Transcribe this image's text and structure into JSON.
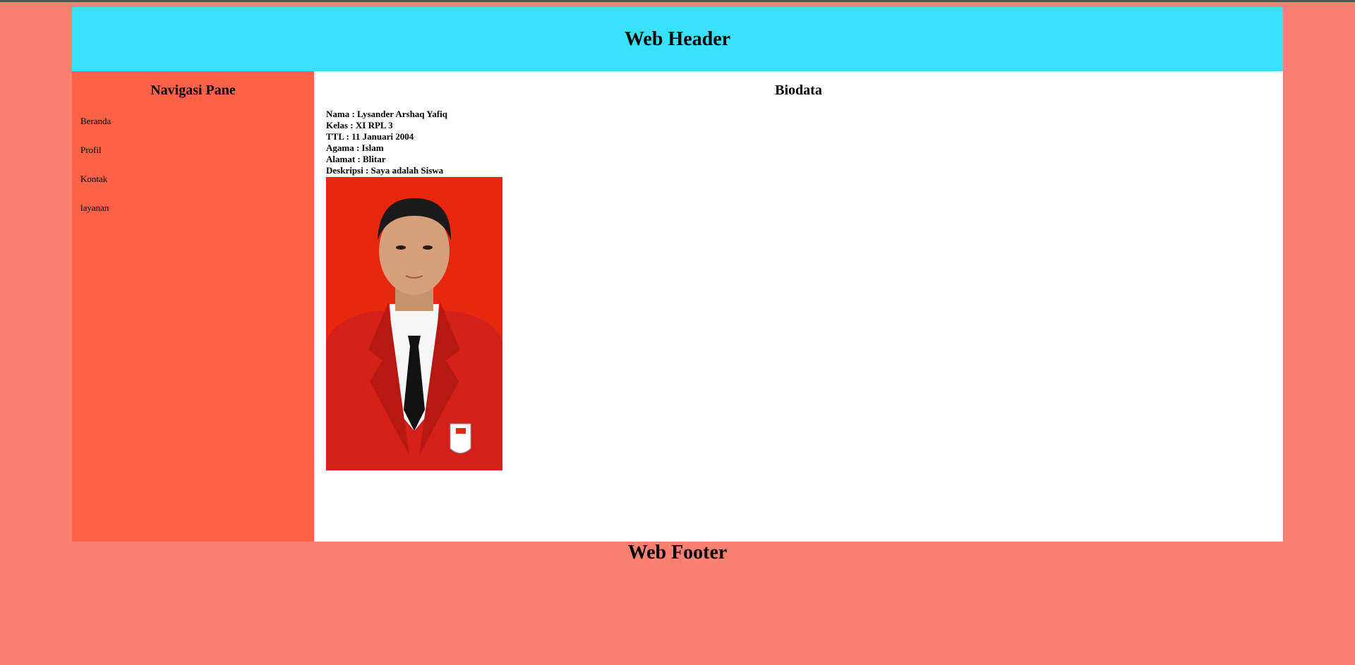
{
  "header": {
    "title": "Web Header"
  },
  "nav": {
    "title": "Navigasi Pane",
    "items": [
      {
        "label": "Beranda"
      },
      {
        "label": "Profil"
      },
      {
        "label": "Kontak"
      },
      {
        "label": "layanan"
      }
    ]
  },
  "main": {
    "title": "Biodata",
    "bio": [
      "Nama : Lysander Arshaq Yafiq",
      "Kelas : XI RPL 3",
      "TTL : 11 Januari 2004",
      "Agama : Islam",
      "Alamat : Blitar",
      "Deskripsi : Saya adalah Siswa"
    ]
  },
  "footer": {
    "title": "Web Footer"
  },
  "colors": {
    "page_bg": "#fa8072",
    "header_bg": "#3ae0f7",
    "nav_bg": "#ff6347",
    "content_bg": "#ffffff",
    "photo_bg": "#e8280e",
    "jacket": "#d3201b"
  }
}
